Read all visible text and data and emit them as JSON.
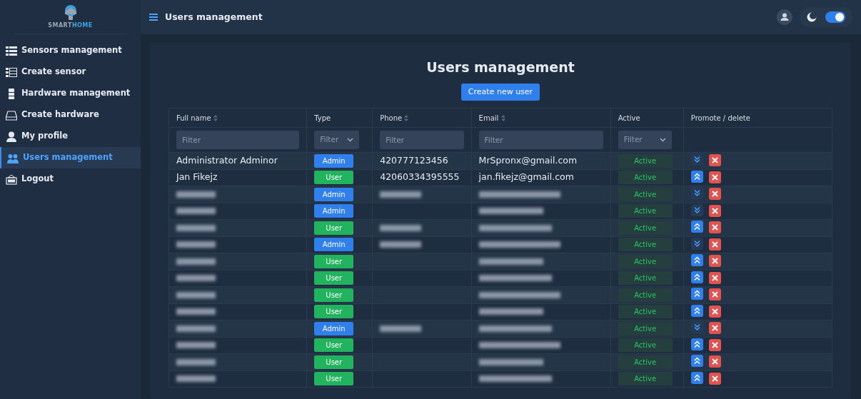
{
  "sidebar": {
    "logo": {
      "word_1": "SMART",
      "word_2": "HOME"
    },
    "items": [
      {
        "label": "Sensors management",
        "selected": false
      },
      {
        "label": "Create sensor",
        "selected": false
      },
      {
        "label": "Hardware management",
        "selected": false
      },
      {
        "label": "Create hardware",
        "selected": false
      },
      {
        "label": "My profile",
        "selected": false
      },
      {
        "label": "Users management",
        "selected": true
      },
      {
        "label": "Logout",
        "selected": false
      }
    ]
  },
  "topbar": {
    "title": "Users management",
    "dark_mode": true
  },
  "page": {
    "title": "Users management",
    "create_button": "Create new user"
  },
  "table": {
    "columns": [
      {
        "label": "Full name",
        "sortable": true,
        "kind": "text",
        "placeholder": "Filter"
      },
      {
        "label": "Type",
        "sortable": false,
        "kind": "select",
        "placeholder": "Filter"
      },
      {
        "label": "Phone",
        "sortable": true,
        "kind": "text",
        "placeholder": "Filter"
      },
      {
        "label": "Email",
        "sortable": true,
        "kind": "text",
        "placeholder": "Filter"
      },
      {
        "label": "Active",
        "sortable": false,
        "kind": "select",
        "placeholder": "Filter"
      },
      {
        "label": "Promote / delete",
        "sortable": false,
        "kind": "none"
      }
    ],
    "rows": [
      {
        "full_name": "Administrator Adminor",
        "type": "Admin",
        "phone": "420777123456",
        "email": "MrSpronx@gmail.com",
        "active": "Active",
        "redacted": false,
        "has_phone": true
      },
      {
        "full_name": "Jan Fikejz",
        "type": "User",
        "phone": "42060334395555",
        "email": "jan.fikejz@gmail.com",
        "active": "Active",
        "redacted": false,
        "has_phone": true
      },
      {
        "type": "Admin",
        "active": "Active",
        "redacted": true,
        "has_phone": true
      },
      {
        "type": "Admin",
        "active": "Active",
        "redacted": true,
        "has_phone": false
      },
      {
        "type": "User",
        "active": "Active",
        "redacted": true,
        "has_phone": true
      },
      {
        "type": "Admin",
        "active": "Active",
        "redacted": true,
        "has_phone": true
      },
      {
        "type": "User",
        "active": "Active",
        "redacted": true,
        "has_phone": false
      },
      {
        "type": "User",
        "active": "Active",
        "redacted": true,
        "has_phone": false
      },
      {
        "type": "User",
        "active": "Active",
        "redacted": true,
        "has_phone": false
      },
      {
        "type": "User",
        "active": "Active",
        "redacted": true,
        "has_phone": false
      },
      {
        "type": "Admin",
        "active": "Active",
        "redacted": true,
        "has_phone": true
      },
      {
        "type": "User",
        "active": "Active",
        "redacted": true,
        "has_phone": false
      },
      {
        "type": "User",
        "active": "Active",
        "redacted": true,
        "has_phone": false
      },
      {
        "type": "User",
        "active": "Active",
        "redacted": true,
        "has_phone": false
      }
    ]
  }
}
